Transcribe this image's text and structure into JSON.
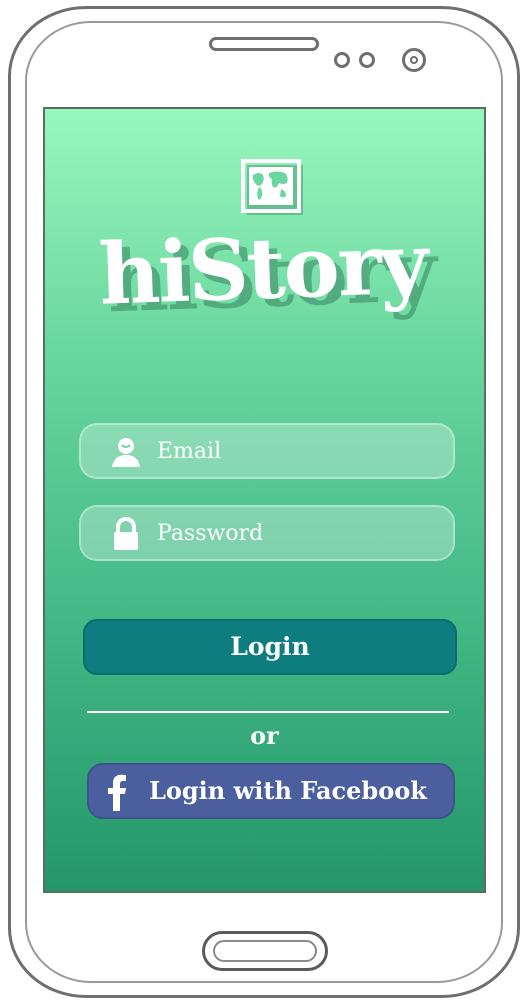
{
  "app": {
    "title": "hiStory"
  },
  "form": {
    "email_placeholder": "Email",
    "password_placeholder": "Password",
    "email_icon": "user-icon",
    "password_icon": "lock-icon"
  },
  "actions": {
    "login_label": "Login",
    "separator_text": "or",
    "facebook_label": "Login with Facebook",
    "facebook_icon": "facebook-icon"
  },
  "colors": {
    "screen_gradient_top": "#98f7bc",
    "screen_gradient_bottom": "#24966a",
    "login_button": "#0d7d80",
    "facebook_button": "#4b5f9f",
    "text": "#ffffff"
  }
}
